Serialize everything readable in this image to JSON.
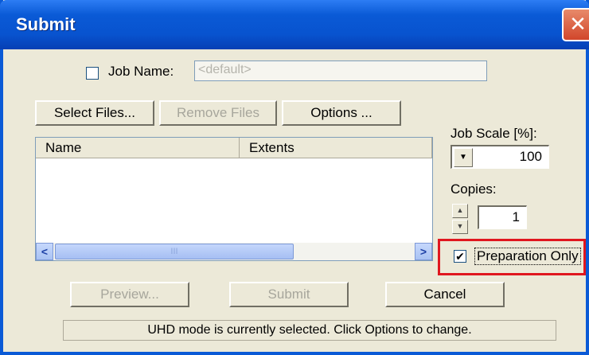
{
  "window": {
    "title": "Submit",
    "close_glyph": "✕"
  },
  "job_name": {
    "label": "Job Name:",
    "checked": false,
    "value": "<default>"
  },
  "buttons": {
    "select_files": "Select Files...",
    "remove_files": "Remove Files",
    "options": "Options ...",
    "preview": "Preview...",
    "submit": "Submit",
    "cancel": "Cancel"
  },
  "file_list": {
    "columns": [
      "Name",
      "Extents"
    ],
    "scroll_left": "<",
    "scroll_right": ">",
    "thumb_grip": "III"
  },
  "job_scale": {
    "label": "Job Scale [%]:",
    "value": "100",
    "dropdown_glyph": "▼"
  },
  "copies": {
    "label": "Copies:",
    "value": "1",
    "up_glyph": "▲",
    "down_glyph": "▼"
  },
  "preparation_only": {
    "label": "Preparation Only",
    "checked": true,
    "check_glyph": "✔"
  },
  "status_text": "UHD mode is currently selected. Click Options to change."
}
